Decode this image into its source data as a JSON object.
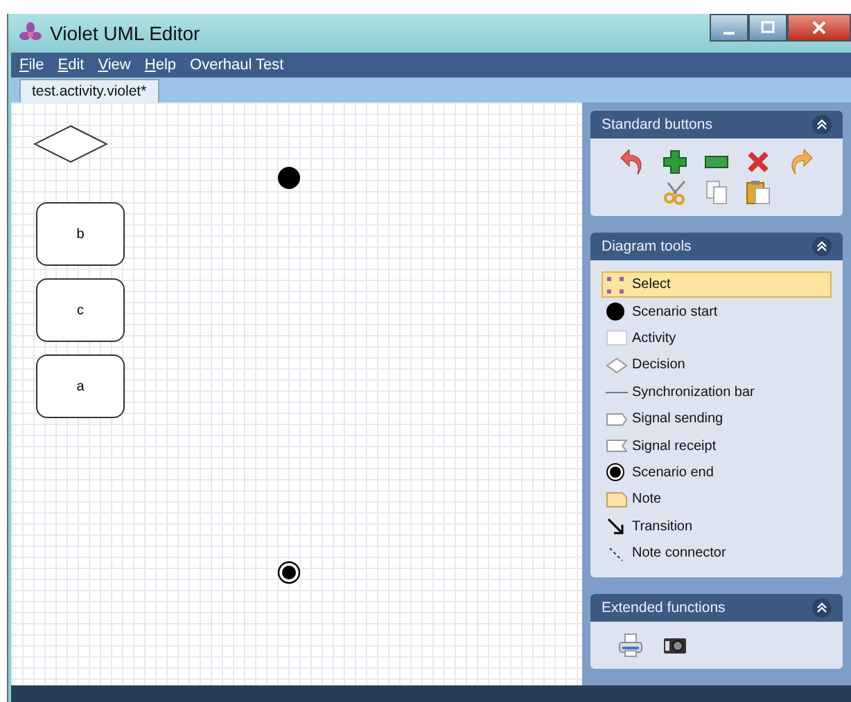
{
  "window": {
    "title": "Violet UML Editor"
  },
  "menu": [
    {
      "label": "File",
      "mnemonic": true
    },
    {
      "label": "Edit",
      "mnemonic": true
    },
    {
      "label": "View",
      "mnemonic": true
    },
    {
      "label": "Help",
      "mnemonic": true
    },
    {
      "label": "Overhaul Test",
      "mnemonic": false
    }
  ],
  "tabs": [
    {
      "label": "test.activity.violet*",
      "selected": true
    }
  ],
  "canvas": {
    "nodes": [
      {
        "kind": "decision"
      },
      {
        "kind": "start"
      },
      {
        "kind": "activity",
        "label": "b"
      },
      {
        "kind": "activity",
        "label": "c"
      },
      {
        "kind": "activity",
        "label": "a"
      },
      {
        "kind": "end"
      }
    ]
  },
  "standard_buttons": {
    "title": "Standard buttons"
  },
  "diagram_tools": {
    "title": "Diagram tools",
    "items": [
      {
        "label": "Select",
        "kind": "select",
        "selected": true
      },
      {
        "label": "Scenario start",
        "kind": "start",
        "selected": false
      },
      {
        "label": "Activity",
        "kind": "activity",
        "selected": false
      },
      {
        "label": "Decision",
        "kind": "decision",
        "selected": false
      },
      {
        "label": "Synchronization bar",
        "kind": "bar",
        "selected": false
      },
      {
        "label": "Signal sending",
        "kind": "send",
        "selected": false
      },
      {
        "label": "Signal receipt",
        "kind": "receipt",
        "selected": false
      },
      {
        "label": "Scenario end",
        "kind": "end",
        "selected": false
      },
      {
        "label": "Note",
        "kind": "note",
        "selected": false
      },
      {
        "label": "Transition",
        "kind": "transition",
        "selected": false
      },
      {
        "label": "Note connector",
        "kind": "connector",
        "selected": false
      }
    ]
  },
  "extended_functions": {
    "title": "Extended functions"
  }
}
